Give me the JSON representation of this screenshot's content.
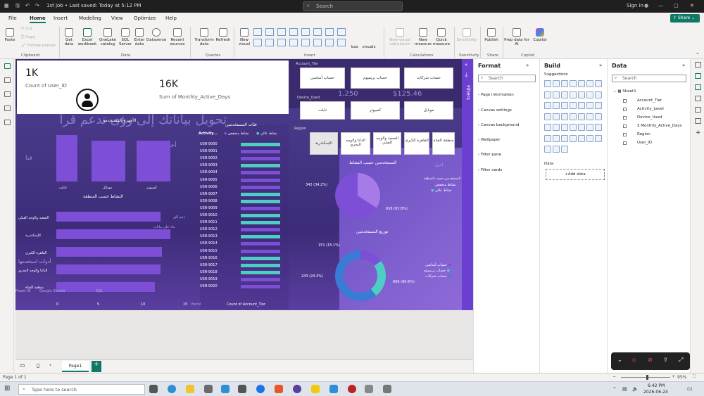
{
  "titlebar": {
    "doc": "1st job • Last saved: Today at 5:12 PM",
    "search": "Search",
    "signin": "Sign in"
  },
  "menus": [
    "File",
    "Home",
    "Insert",
    "Modeling",
    "View",
    "Optimize",
    "Help"
  ],
  "share": "Share",
  "ribbon": {
    "clipboard": {
      "paste": "Paste",
      "cut": "Cut",
      "copy": "Copy",
      "format_painter": "Format painter",
      "group": "Clipboard"
    },
    "data": {
      "get_data": "Get data",
      "excel": "Excel workbook",
      "onelake": "OneLake catalog",
      "sql": "SQL Server",
      "enter": "Enter data",
      "dataverse": "Dataverse",
      "recent": "Recent sources",
      "group": "Data"
    },
    "queries": {
      "transform": "Transform data",
      "refresh": "Refresh",
      "group": "Queries"
    },
    "insert": {
      "new_visual": "New visual",
      "text_box": "box",
      "more_visuals": "visuals",
      "group": "Insert"
    },
    "calculations": {
      "new_visual_calc": "New visual calculation",
      "new_measure": "New measure",
      "quick_measure": "Quick measure",
      "group": "Calculations"
    },
    "sensitivity": {
      "label": "Sensitivity",
      "group": "Sensitivity"
    },
    "share": {
      "publish": "Publish",
      "group": "Share"
    },
    "copilot": {
      "prep": "Prep data for AI",
      "copilot": "Copilot",
      "group": "Copilot"
    }
  },
  "kpi": {
    "users_value": "1K",
    "users_label": "Count of User_ID",
    "days_value": "16K",
    "days_label": "Sum of Monthly_Active_Days"
  },
  "canvas_bg_text": {
    "headline": "تحويل بياناتك إلى رؤى تدعم قرا",
    "sub": "أحلل بيا",
    "fd": "قنا",
    "stats": [
      "1,250",
      "$125.46"
    ]
  },
  "slicers": {
    "account_tier": {
      "title": "Account_Tier",
      "options": [
        "حساب أساسي",
        "حساب بريميوم",
        "حساب شركات"
      ]
    },
    "device": {
      "title": "Device_Used",
      "options": [
        "تابلت",
        "كمبيوتر",
        "موبايل"
      ]
    },
    "region": {
      "title": "Region",
      "options": [
        "الإسكندرية",
        "الدلتا والوجه البحري",
        "الصعيد والوجه القبلي",
        "القاهرة الكبرى",
        "منطقة القناة"
      ]
    }
  },
  "devices_chart": {
    "title": "الأجهزة المستخدمة",
    "labels": [
      "تابلت",
      "موبايل",
      "كمبيوتر"
    ]
  },
  "region_chart": {
    "title": "النشاط حسب المنطقة",
    "labels": [
      "الصعيد والوجه القبلي",
      "الإسكندرية",
      "القاهرة الكبرى",
      "الدلتا والوجه البحري",
      "منطقة القناة"
    ],
    "axis": [
      "0",
      "5",
      "10",
      "15"
    ]
  },
  "activity_chart": {
    "title": "فئات المستخدمين",
    "legend_label": "Activity...",
    "legend": [
      "نشاط منخفض",
      "نشاط عالي"
    ],
    "xlabel": "Count of Account_Tier",
    "users": [
      "USR-9000",
      "USR-9001",
      "USR-9002",
      "USR-9003",
      "USR-9004",
      "USR-9005",
      "USR-9006",
      "USR-9007",
      "USR-9008",
      "USR-9009",
      "USR-9010",
      "USR-9011",
      "USR-9012",
      "USR-9013",
      "USR-9014",
      "USR-9015",
      "USR-9016",
      "USR-9017",
      "USR-9018",
      "USR-9019",
      "USR-9020"
    ]
  },
  "pie_chart": {
    "title": "المستخدمين حسب النشاط",
    "legend_title": "المستخدمين حسب المنطقة",
    "legend": [
      "نشاط منخفض",
      "نشاط عالي"
    ],
    "label_low": "342 (34.2%)",
    "label_high": "658 (65.8%)",
    "faint_label": "أخرى"
  },
  "donut_chart": {
    "title": "توزيع المستخدمين",
    "legend": [
      "حساب أساسي",
      "حساب بريميوم",
      "حساب شركات"
    ],
    "label_a": "151 (15.1%)",
    "label_b": "243 (24.3%)",
    "label_c": "606 (60.6%)"
  },
  "bg_labels": [
    "دعم الق",
    "بناء على بيانات",
    "أدوات استخدمها",
    "Power BI",
    "Google Sheets",
    "SQL",
    "Excel"
  ],
  "filters_label": "Filters",
  "format_pane": {
    "title": "Format",
    "search": "Search",
    "items": [
      "Page information",
      "Canvas settings",
      "Canvas background",
      "Wallpaper",
      "Filter pane",
      "Filter cards"
    ]
  },
  "build_pane": {
    "title": "Build",
    "suggestions": "Suggestions",
    "data_label": "Data",
    "add_data": "+Add data"
  },
  "data_pane": {
    "title": "Data",
    "search": "Search",
    "table": "Sheet1",
    "fields": [
      "Account_Tier",
      "Activity_Level",
      "Device_Used",
      "Monthly_Active_Days",
      "Region",
      "User_ID"
    ]
  },
  "pagebar": {
    "page": "Page1",
    "add": "+"
  },
  "statusbar": {
    "page": "Page 1 of 1",
    "zoom": "95%"
  },
  "taskbar": {
    "search": "Type here to search",
    "time": "6:42 PM",
    "date": "2026-06-24"
  },
  "colors": {
    "accent": "#117865",
    "purple": "#7d4fd6",
    "teal": "#4ecdc4",
    "canvas": "#3b2a6e"
  }
}
